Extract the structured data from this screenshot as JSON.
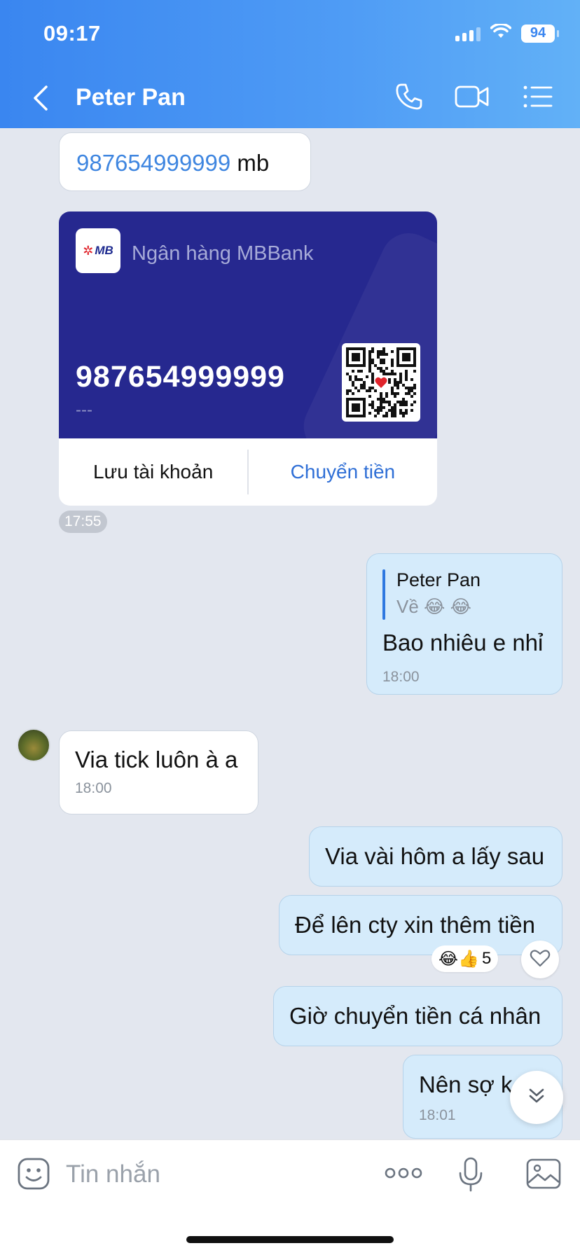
{
  "status_bar": {
    "time": "09:17",
    "battery": "94"
  },
  "header": {
    "title": "Peter Pan"
  },
  "messages": {
    "account_text": {
      "number": "987654999999",
      "suffix": " mb"
    },
    "bank_card": {
      "bank_name": "Ngân hàng MBBank",
      "logo_text": "MB",
      "account_number": "987654999999",
      "holder": "---",
      "save_label": "Lưu tài khoản",
      "transfer_label": "Chuyển tiền",
      "time": "17:55"
    },
    "reply_msg": {
      "quote_author": "Peter Pan",
      "quote_text": "Về 😂 😂",
      "text": "Bao nhiêu e nhỉ",
      "time": "18:00"
    },
    "incoming_msg": {
      "text": "Via tick luôn à a",
      "time": "18:00"
    },
    "out1": {
      "text": "Via vài hôm a lấy sau"
    },
    "out2": {
      "text": "Để lên cty xin thêm tiền",
      "reactions": "😂👍",
      "reaction_count": "5"
    },
    "out3": {
      "text": "Giờ chuyển tiền cá nhân"
    },
    "out4": {
      "text": "Nên sợ k",
      "time": "18:01"
    }
  },
  "input_bar": {
    "placeholder": "Tin nhắn"
  },
  "colors": {
    "header_start": "#3a86f0",
    "header_end": "#62b1f7",
    "link": "#2f6fd6",
    "card_bg": "#26288f",
    "outgoing_bubble": "#d5ebfb"
  },
  "icons": [
    "back-icon",
    "phone-icon",
    "video-icon",
    "menu-icon",
    "sticker-icon",
    "more-icon",
    "mic-icon",
    "image-icon",
    "heart-icon",
    "chevron-down-icon"
  ]
}
